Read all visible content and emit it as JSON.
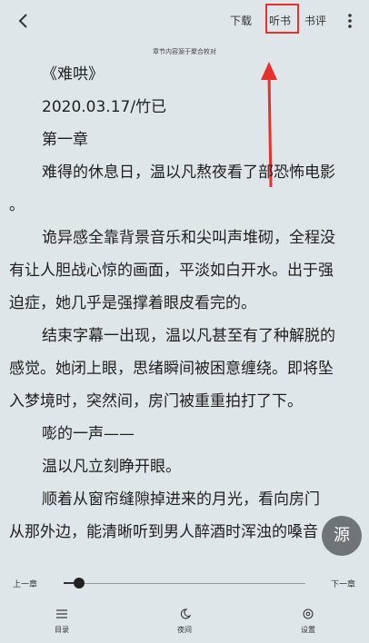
{
  "header": {
    "download_label": "下载",
    "listen_label": "听书",
    "review_label": "书评"
  },
  "source_note": "章节内容源于聚合枚对",
  "content": {
    "lines": [
      "《难哄》",
      "2020.03.17/竹已",
      "第一章",
      "难得的休息日，温以凡熬夜看了部恐怖电影",
      "。",
      "诡异感全靠背景音乐和尖叫声堆砌，全程没",
      "有让人胆战心惊的画面，平淡如白开水。出于强",
      "迫症，她几乎是强撑着眼皮看完的。",
      "结束字幕一出现，温以凡甚至有了种解脱的",
      "感觉。她闭上眼，思绪瞬间被困意缠绕。即将坠",
      "入梦境时，突然间，房门被重重拍打了下。",
      "嘭的一声——",
      "温以凡立刻睁开眼。",
      "顺着从窗帘缝隙掉进来的月光，看向房门",
      "从那外边，能清晰听到男人醉酒时浑浊的嗓音"
    ]
  },
  "source_button_label": "源",
  "chapter_nav": {
    "prev_label": "上一章",
    "next_label": "下一章",
    "progress_fraction": 0.05
  },
  "bottom_bar": {
    "toc_label": "目录",
    "night_label": "夜间",
    "settings_label": "设置"
  },
  "colors": {
    "background": "#dfe6ea",
    "highlight": "#e8302c",
    "source_button": "#6f7478"
  },
  "icons": {
    "back": "back-arrow-icon",
    "more": "more-vertical-icon",
    "toc": "menu-list-icon",
    "night": "moon-icon",
    "settings": "settings-icon"
  }
}
